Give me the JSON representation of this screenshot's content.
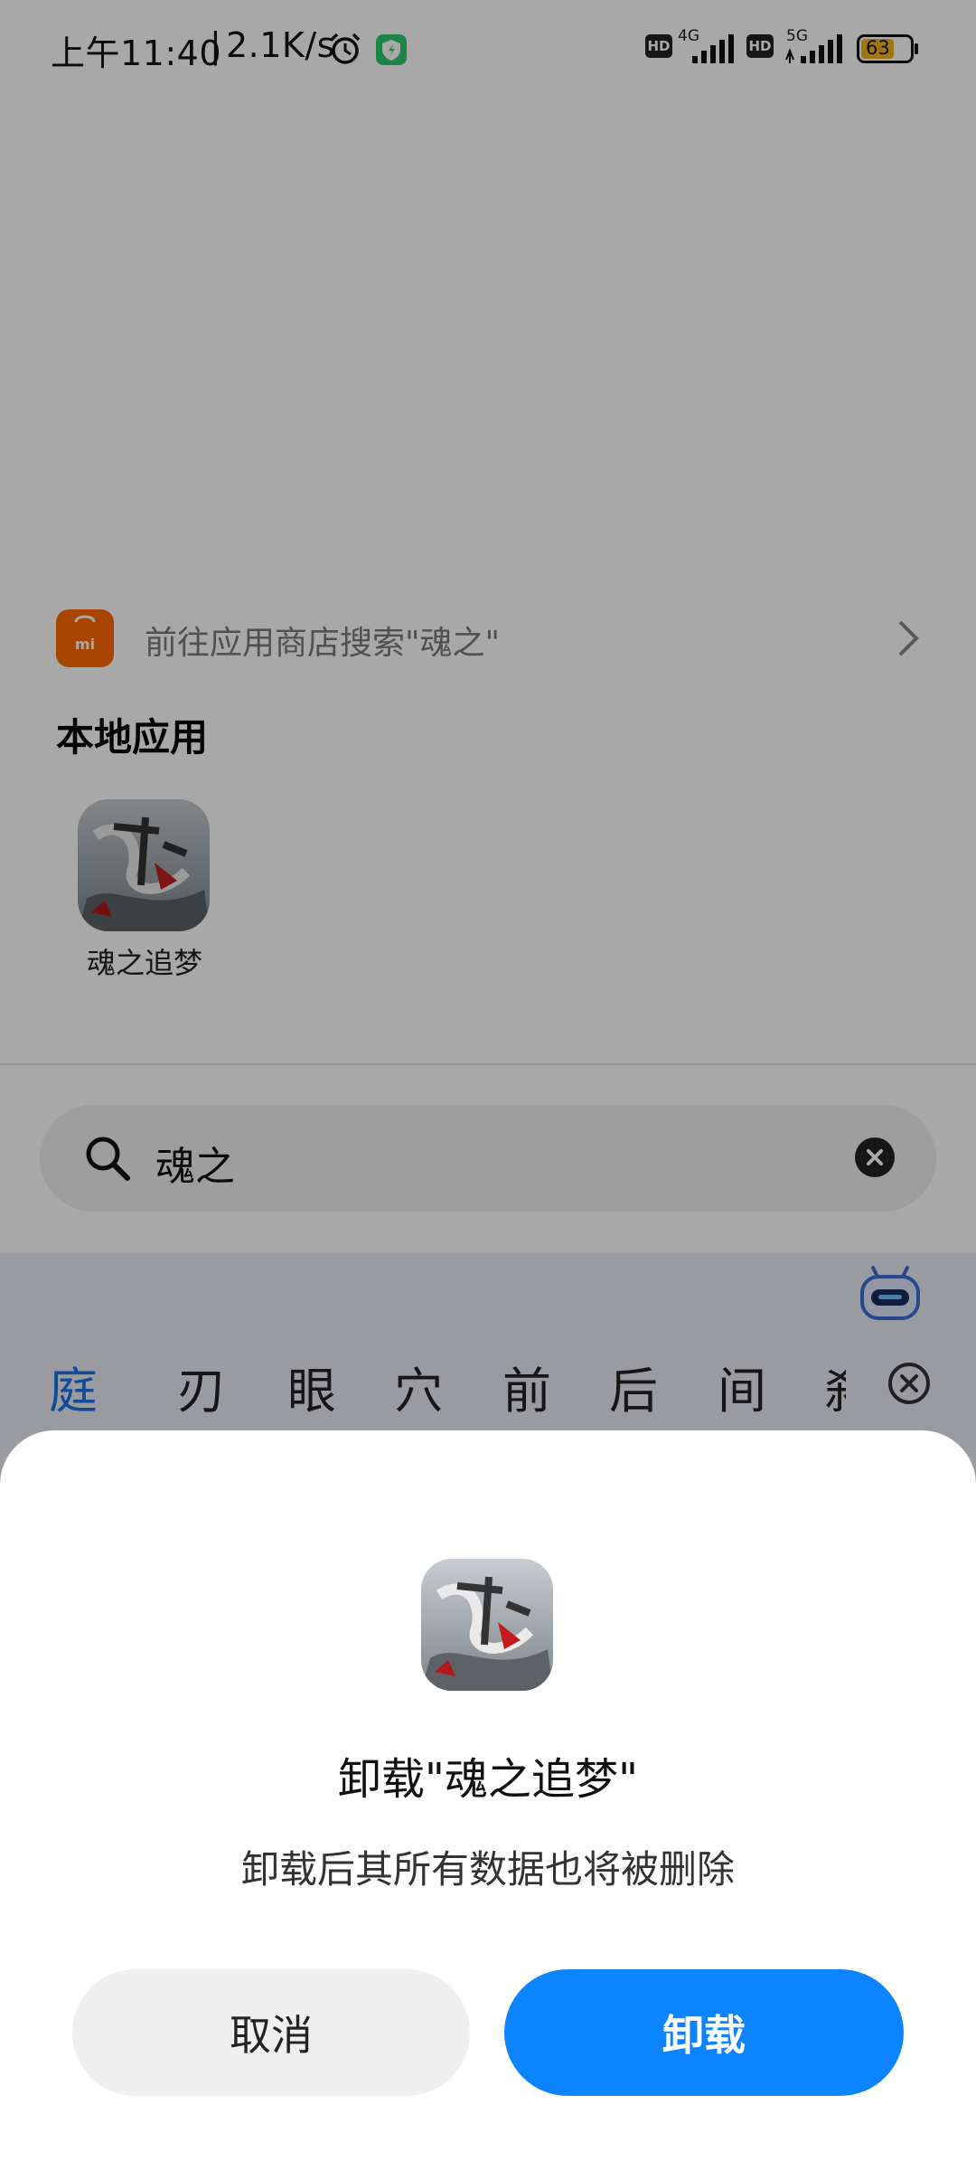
{
  "status_bar": {
    "time": "上午11:40",
    "net_speed": "2.1K/s",
    "alarm_icon": "alarm-icon",
    "shield_icon": "security-shield-icon",
    "hd1": "HD",
    "net1": "4G",
    "hd2": "HD",
    "net2": "5G",
    "battery": "63",
    "battery_color": "#f5b31b"
  },
  "store_search": {
    "text": "前往应用商店搜索\"魂之\"",
    "icon": "mi-store-icon",
    "chevron": "chevron-right-icon",
    "store_color": "#ff6a00"
  },
  "local_apps": {
    "title": "本地应用",
    "items": [
      {
        "label": "魂之追梦",
        "icon": "game-app-icon"
      }
    ]
  },
  "search": {
    "query": "魂之",
    "icon": "search-icon",
    "clear_icon": "clear-icon"
  },
  "keyboard": {
    "candidates": [
      "庭",
      "刃",
      "眼",
      "穴",
      "前",
      "后",
      "间",
      "刹"
    ],
    "highlight_color": "#1a73e8",
    "assistant_icon": "assistant-bot-icon",
    "close_icon": "candidate-close-icon"
  },
  "dialog": {
    "title": "卸载\"魂之追梦\"",
    "message": "卸载后其所有数据也将被删除",
    "cancel_label": "取消",
    "uninstall_label": "卸载",
    "primary_color": "#0d84ff"
  }
}
